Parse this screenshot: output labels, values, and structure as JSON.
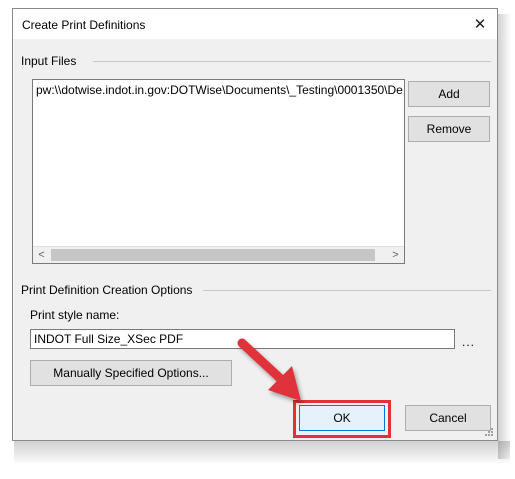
{
  "dialog": {
    "title": "Create Print Definitions",
    "close_glyph": "✕"
  },
  "input_files": {
    "group_label": "Input Files",
    "items": [
      "pw:\\\\dotwise.indot.in.gov:DOTWise\\Documents\\_Testing\\0001350\\De"
    ],
    "scroll_left_glyph": "<",
    "scroll_right_glyph": ">",
    "add_label": "Add",
    "remove_label": "Remove"
  },
  "options": {
    "group_label": "Print Definition Creation Options",
    "style_name_label": "Print style name:",
    "style_name_value": "INDOT Full Size_XSec PDF",
    "browse_label": "...",
    "manual_options_label": "Manually Specified Options..."
  },
  "footer": {
    "ok_label": "OK",
    "cancel_label": "Cancel"
  },
  "annotation": {
    "arrow_color": "#e0303a",
    "highlight_color": "#e0303a"
  },
  "icons": {
    "close": "close-icon",
    "arrow": "red-arrow-icon",
    "grip": "resize-grip-icon"
  }
}
